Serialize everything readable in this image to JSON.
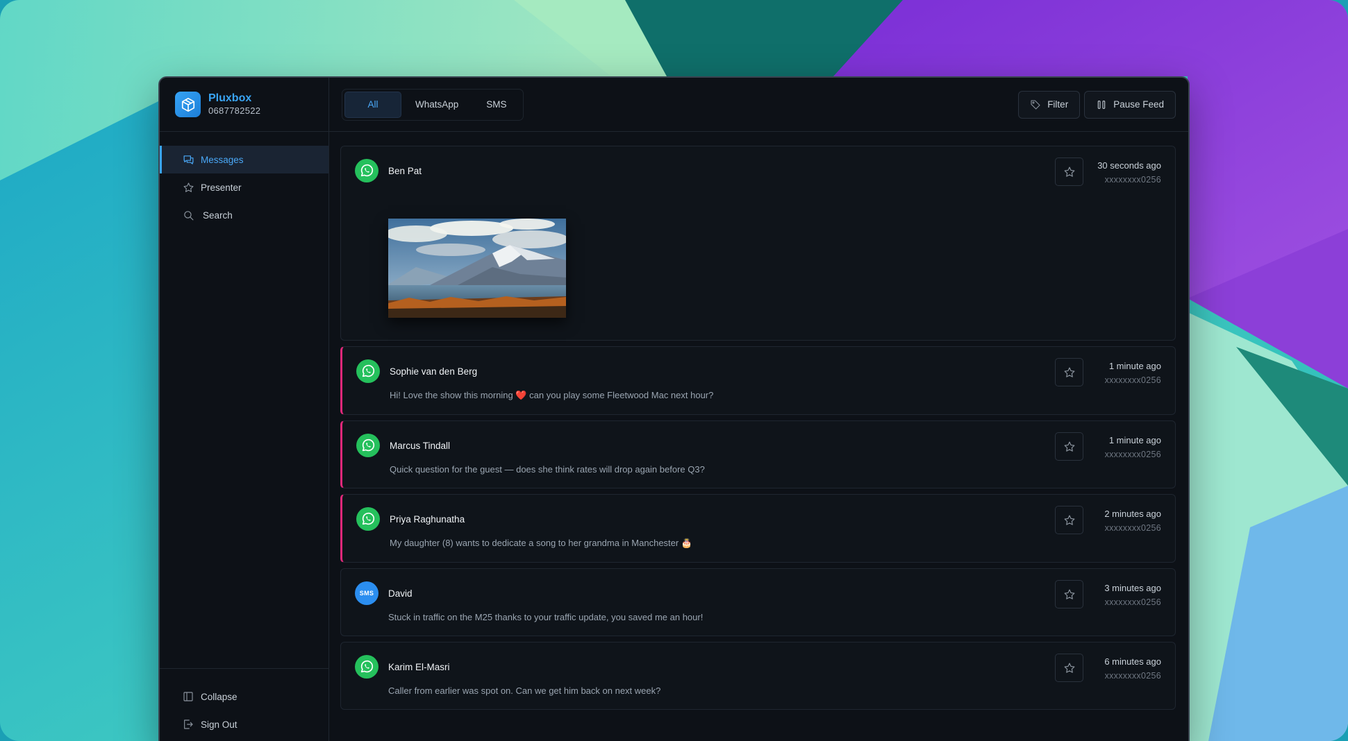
{
  "brand": {
    "name": "Pluxbox",
    "number": "0687782522",
    "icon": "cube-icon"
  },
  "sidebar": {
    "items": [
      {
        "label": "Messages",
        "icon": "chat-icon",
        "active": true
      },
      {
        "label": "Presenter",
        "icon": "star-icon",
        "active": false
      },
      {
        "label": "Search",
        "icon": "search-icon",
        "active": false
      }
    ],
    "bottom": [
      {
        "label": "Collapse",
        "icon": "panel-icon"
      },
      {
        "label": "Sign Out",
        "icon": "sign-out-icon"
      }
    ]
  },
  "tabs": [
    {
      "label": "All",
      "active": true
    },
    {
      "label": "WhatsApp",
      "active": false
    },
    {
      "label": "SMS",
      "active": false
    }
  ],
  "toolbar": {
    "filter_label": "Filter",
    "pause_label": "Pause Feed"
  },
  "messages": [
    {
      "sender": "Ben Pat",
      "channel": "whatsapp",
      "time": "30 seconds ago",
      "phone": "xxxxxxxx0256",
      "text": "",
      "has_image": true,
      "flagged": false
    },
    {
      "sender": "Sophie van den Berg",
      "channel": "whatsapp",
      "time": "1 minute ago",
      "phone": "xxxxxxxx0256",
      "text": "Hi! Love the show this morning ❤️ can you play some Fleetwood Mac next hour?",
      "flagged": true
    },
    {
      "sender": "Marcus Tindall",
      "channel": "whatsapp",
      "time": "1 minute ago",
      "phone": "xxxxxxxx0256",
      "text": "Quick question for the guest — does she think rates will drop again before Q3?",
      "flagged": true
    },
    {
      "sender": "Priya Raghunatha",
      "channel": "whatsapp",
      "time": "2 minutes ago",
      "phone": "xxxxxxxx0256",
      "text": "My daughter (8) wants to dedicate a song to her grandma in Manchester 🎂",
      "flagged": true
    },
    {
      "sender": "David",
      "channel": "sms",
      "sms_badge": "SMS",
      "time": "3 minutes ago",
      "phone": "xxxxxxxx0256",
      "text": "Stuck in traffic on the M25 thanks to your traffic update, you saved me an hour!",
      "flagged": false
    },
    {
      "sender": "Karim El-Masri",
      "channel": "whatsapp",
      "time": "6 minutes ago",
      "phone": "xxxxxxxx0256",
      "text": "Caller from earlier was spot on. Can we get him back on next week?",
      "flagged": false
    }
  ],
  "colors": {
    "accent": "#3aa5f5",
    "whatsapp": "#25c05c",
    "sms": "#2b8ef0",
    "flag": "#e0287a"
  }
}
